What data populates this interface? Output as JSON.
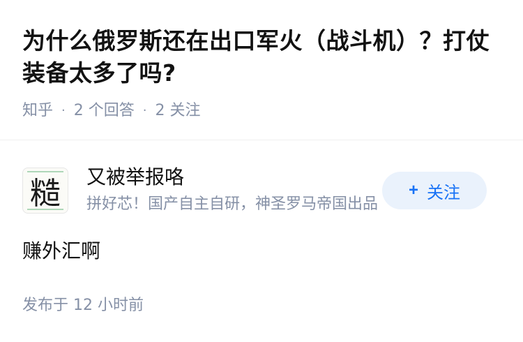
{
  "question": {
    "title": "为什么俄罗斯还在出口军火（战斗机）？打仗装备太多了吗?",
    "source": "知乎",
    "separator": "·",
    "answers_count": "2 个回答",
    "followers_count": "2 关注"
  },
  "author": {
    "avatar_char": "糙",
    "name": "又被举报咯",
    "bio": "拼好芯！国产自主自研，神圣罗马帝国出品",
    "follow_plus": "+",
    "follow_label": "关注"
  },
  "answer": {
    "text": "赚外汇啊",
    "published": "发布于 12 小时前"
  },
  "colors": {
    "accent": "#1772f6",
    "follow_bg": "#eaf2fc",
    "meta_gray": "#8590a6"
  }
}
